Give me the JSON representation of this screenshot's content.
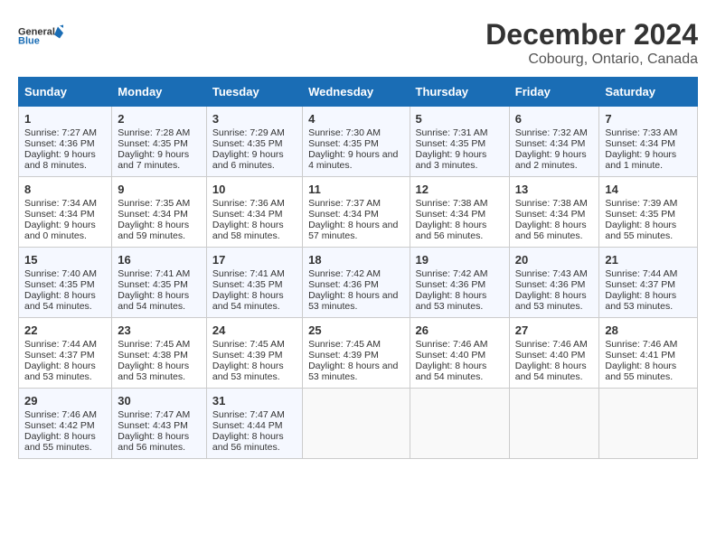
{
  "header": {
    "logo_line1": "General",
    "logo_line2": "Blue",
    "title": "December 2024",
    "subtitle": "Cobourg, Ontario, Canada"
  },
  "days_of_week": [
    "Sunday",
    "Monday",
    "Tuesday",
    "Wednesday",
    "Thursday",
    "Friday",
    "Saturday"
  ],
  "weeks": [
    [
      {
        "day": "1",
        "sunrise": "7:27 AM",
        "sunset": "4:36 PM",
        "daylight": "9 hours and 8 minutes."
      },
      {
        "day": "2",
        "sunrise": "7:28 AM",
        "sunset": "4:35 PM",
        "daylight": "9 hours and 7 minutes."
      },
      {
        "day": "3",
        "sunrise": "7:29 AM",
        "sunset": "4:35 PM",
        "daylight": "9 hours and 6 minutes."
      },
      {
        "day": "4",
        "sunrise": "7:30 AM",
        "sunset": "4:35 PM",
        "daylight": "9 hours and 4 minutes."
      },
      {
        "day": "5",
        "sunrise": "7:31 AM",
        "sunset": "4:35 PM",
        "daylight": "9 hours and 3 minutes."
      },
      {
        "day": "6",
        "sunrise": "7:32 AM",
        "sunset": "4:34 PM",
        "daylight": "9 hours and 2 minutes."
      },
      {
        "day": "7",
        "sunrise": "7:33 AM",
        "sunset": "4:34 PM",
        "daylight": "9 hours and 1 minute."
      }
    ],
    [
      {
        "day": "8",
        "sunrise": "7:34 AM",
        "sunset": "4:34 PM",
        "daylight": "9 hours and 0 minutes."
      },
      {
        "day": "9",
        "sunrise": "7:35 AM",
        "sunset": "4:34 PM",
        "daylight": "8 hours and 59 minutes."
      },
      {
        "day": "10",
        "sunrise": "7:36 AM",
        "sunset": "4:34 PM",
        "daylight": "8 hours and 58 minutes."
      },
      {
        "day": "11",
        "sunrise": "7:37 AM",
        "sunset": "4:34 PM",
        "daylight": "8 hours and 57 minutes."
      },
      {
        "day": "12",
        "sunrise": "7:38 AM",
        "sunset": "4:34 PM",
        "daylight": "8 hours and 56 minutes."
      },
      {
        "day": "13",
        "sunrise": "7:38 AM",
        "sunset": "4:34 PM",
        "daylight": "8 hours and 56 minutes."
      },
      {
        "day": "14",
        "sunrise": "7:39 AM",
        "sunset": "4:35 PM",
        "daylight": "8 hours and 55 minutes."
      }
    ],
    [
      {
        "day": "15",
        "sunrise": "7:40 AM",
        "sunset": "4:35 PM",
        "daylight": "8 hours and 54 minutes."
      },
      {
        "day": "16",
        "sunrise": "7:41 AM",
        "sunset": "4:35 PM",
        "daylight": "8 hours and 54 minutes."
      },
      {
        "day": "17",
        "sunrise": "7:41 AM",
        "sunset": "4:35 PM",
        "daylight": "8 hours and 54 minutes."
      },
      {
        "day": "18",
        "sunrise": "7:42 AM",
        "sunset": "4:36 PM",
        "daylight": "8 hours and 53 minutes."
      },
      {
        "day": "19",
        "sunrise": "7:42 AM",
        "sunset": "4:36 PM",
        "daylight": "8 hours and 53 minutes."
      },
      {
        "day": "20",
        "sunrise": "7:43 AM",
        "sunset": "4:36 PM",
        "daylight": "8 hours and 53 minutes."
      },
      {
        "day": "21",
        "sunrise": "7:44 AM",
        "sunset": "4:37 PM",
        "daylight": "8 hours and 53 minutes."
      }
    ],
    [
      {
        "day": "22",
        "sunrise": "7:44 AM",
        "sunset": "4:37 PM",
        "daylight": "8 hours and 53 minutes."
      },
      {
        "day": "23",
        "sunrise": "7:45 AM",
        "sunset": "4:38 PM",
        "daylight": "8 hours and 53 minutes."
      },
      {
        "day": "24",
        "sunrise": "7:45 AM",
        "sunset": "4:39 PM",
        "daylight": "8 hours and 53 minutes."
      },
      {
        "day": "25",
        "sunrise": "7:45 AM",
        "sunset": "4:39 PM",
        "daylight": "8 hours and 53 minutes."
      },
      {
        "day": "26",
        "sunrise": "7:46 AM",
        "sunset": "4:40 PM",
        "daylight": "8 hours and 54 minutes."
      },
      {
        "day": "27",
        "sunrise": "7:46 AM",
        "sunset": "4:40 PM",
        "daylight": "8 hours and 54 minutes."
      },
      {
        "day": "28",
        "sunrise": "7:46 AM",
        "sunset": "4:41 PM",
        "daylight": "8 hours and 55 minutes."
      }
    ],
    [
      {
        "day": "29",
        "sunrise": "7:46 AM",
        "sunset": "4:42 PM",
        "daylight": "8 hours and 55 minutes."
      },
      {
        "day": "30",
        "sunrise": "7:47 AM",
        "sunset": "4:43 PM",
        "daylight": "8 hours and 56 minutes."
      },
      {
        "day": "31",
        "sunrise": "7:47 AM",
        "sunset": "4:44 PM",
        "daylight": "8 hours and 56 minutes."
      },
      {
        "day": "",
        "sunrise": "",
        "sunset": "",
        "daylight": ""
      },
      {
        "day": "",
        "sunrise": "",
        "sunset": "",
        "daylight": ""
      },
      {
        "day": "",
        "sunrise": "",
        "sunset": "",
        "daylight": ""
      },
      {
        "day": "",
        "sunrise": "",
        "sunset": "",
        "daylight": ""
      }
    ]
  ],
  "labels": {
    "sunrise_prefix": "Sunrise: ",
    "sunset_prefix": "Sunset: ",
    "daylight_prefix": "Daylight: "
  }
}
